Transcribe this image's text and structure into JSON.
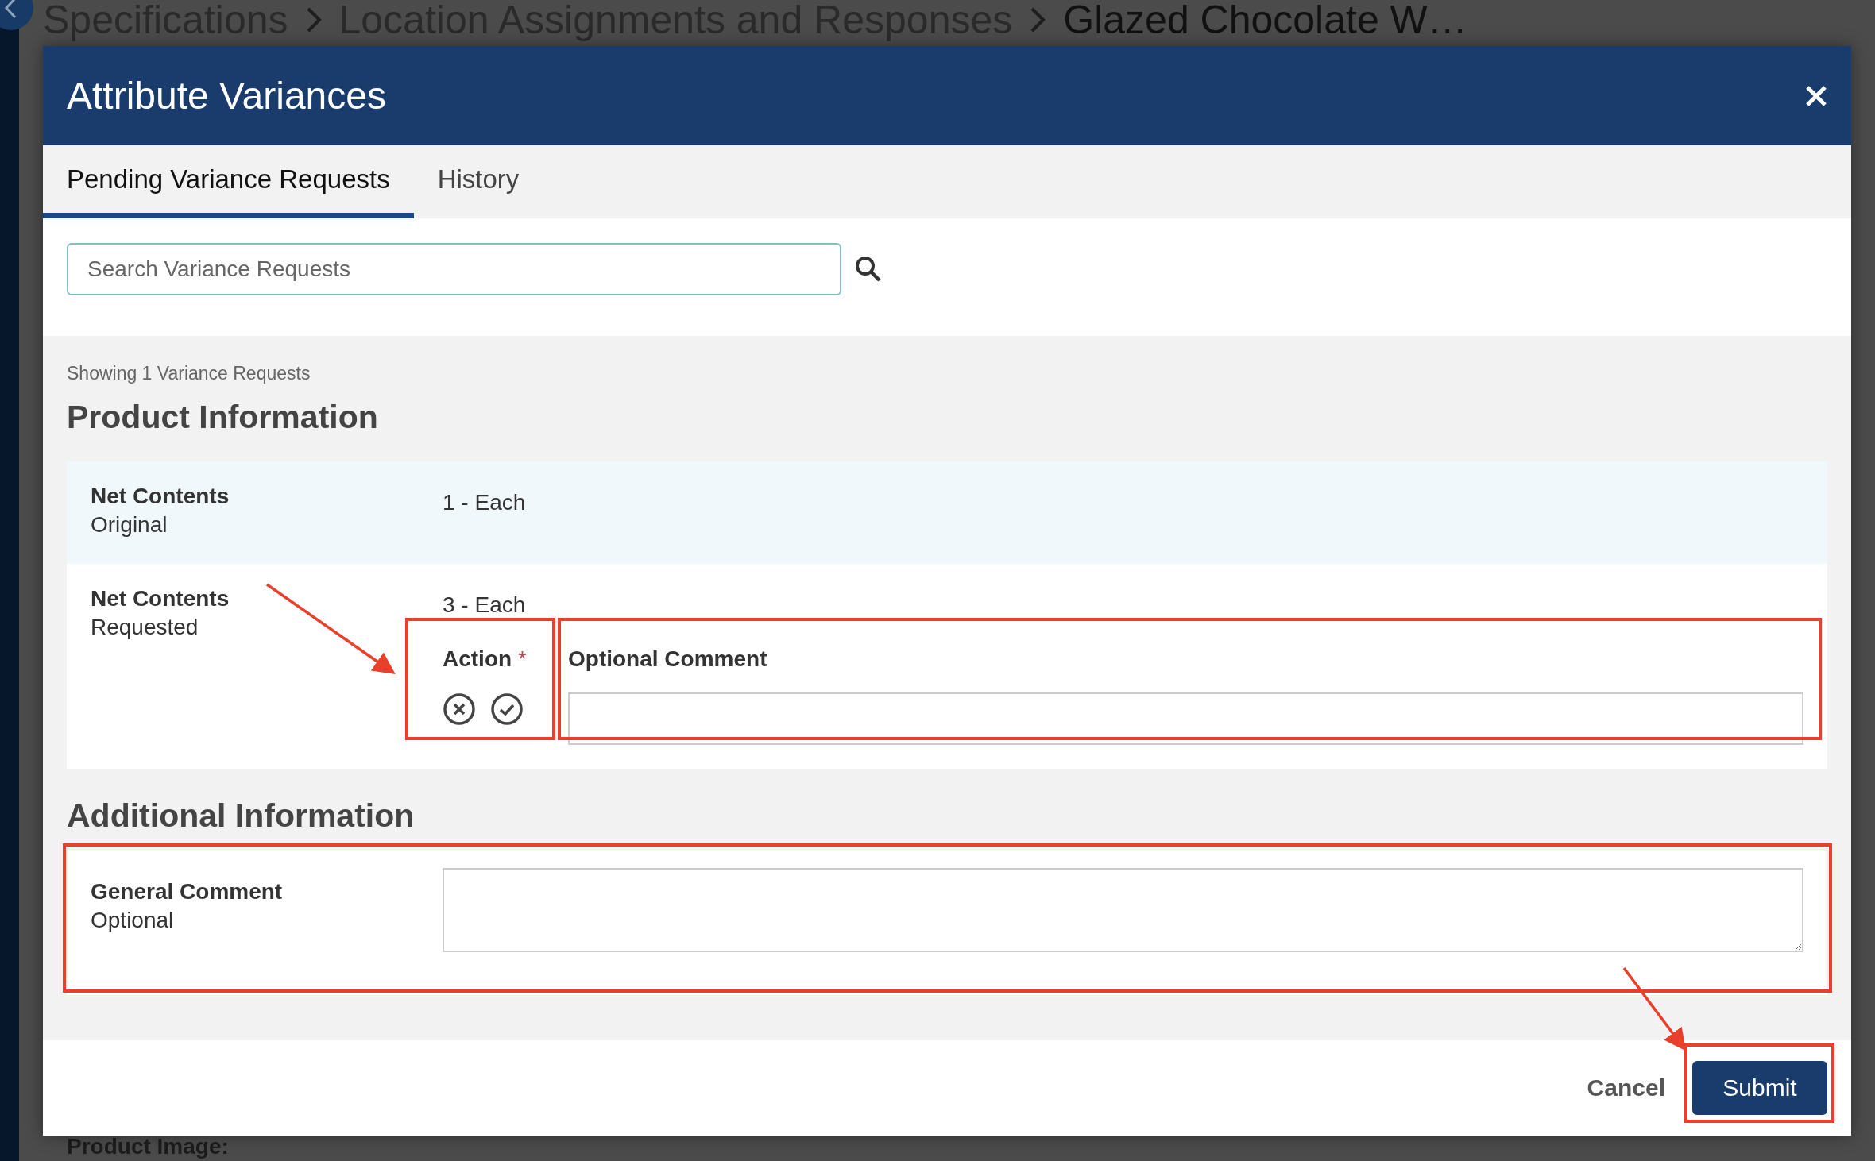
{
  "backdrop": {
    "breadcrumb": [
      "Specifications",
      "Location Assignments and Responses",
      "Glazed Chocolate W…"
    ],
    "product_image_label": "Product Image:"
  },
  "dialog": {
    "title": "Attribute Variances",
    "tabs": [
      {
        "label": "Pending Variance Requests",
        "selected": true
      },
      {
        "label": "History",
        "selected": false
      }
    ],
    "search": {
      "placeholder": "Search Variance Requests"
    },
    "result_count": "Showing 1 Variance Requests",
    "product_section": {
      "heading": "Product Information",
      "rows": [
        {
          "label": "Net Contents",
          "sublabel": "Original",
          "value": "1 - Each",
          "highlighted": true
        },
        {
          "label": "Net Contents",
          "sublabel": "Requested",
          "value": "3 - Each",
          "highlighted": false
        }
      ],
      "action": {
        "label": "Action",
        "required_mark": "*",
        "reject_selected": false,
        "approve_selected": false
      },
      "comment": {
        "label": "Optional Comment"
      }
    },
    "additional_section": {
      "heading": "Additional Information",
      "label": "General Comment",
      "sublabel": "Optional"
    },
    "buttons": [
      {
        "label": "Cancel",
        "kind": "link"
      },
      {
        "label": "Submit",
        "kind": "primary"
      }
    ]
  }
}
